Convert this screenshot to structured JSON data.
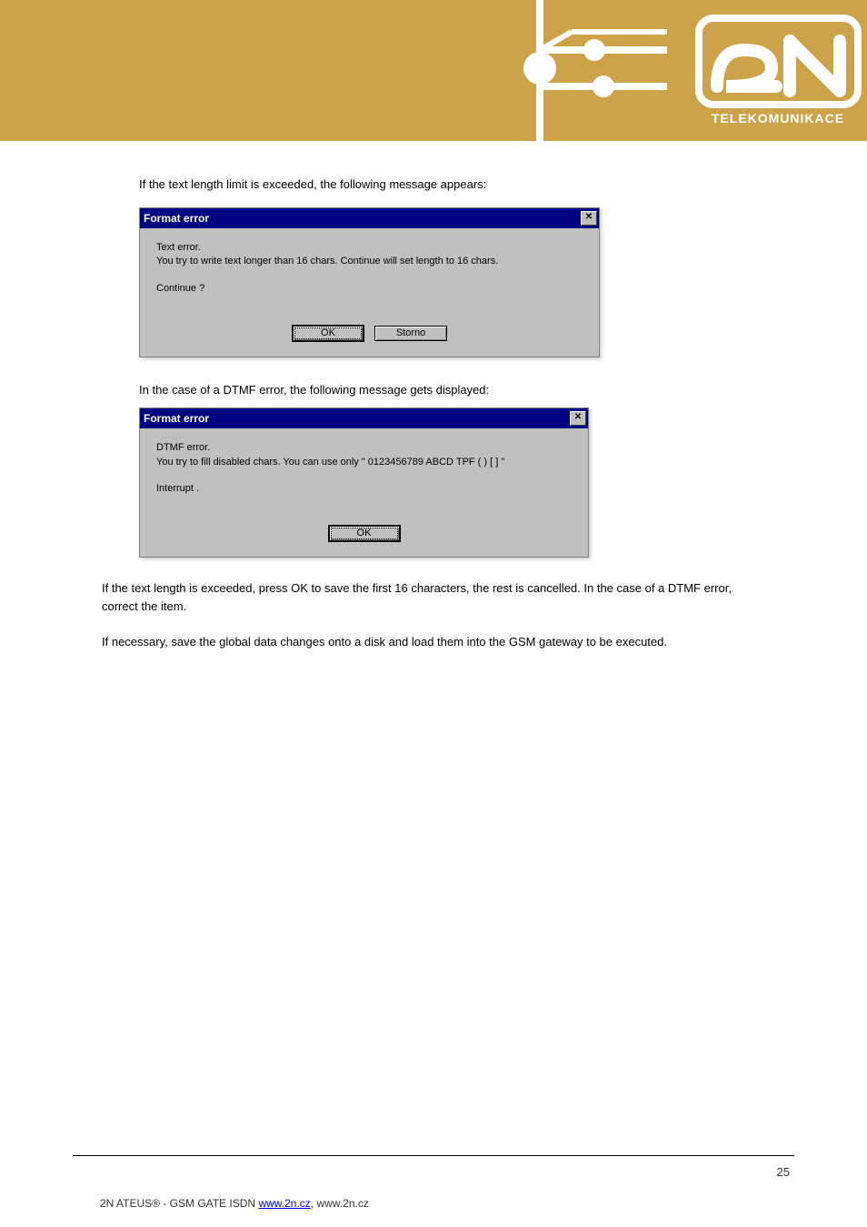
{
  "header": {
    "brand_text": "TELEKOMUNIKACE"
  },
  "intro": "If the text length limit is exceeded, the following message appears:",
  "dialog1": {
    "title": "Format error",
    "line1": "Text error.",
    "line2": "You try to write text longer than 16 chars. Continue will set length to 16 chars.",
    "line3": "Continue ?",
    "ok": "OK",
    "cancel": "Storno"
  },
  "mid": "In the case of a DTMF error, the following message gets displayed:",
  "dialog2": {
    "title": "Format error",
    "line1": "DTMF error.",
    "line2": "You try to fill disabled chars. You can use only \" 0123456789 ABCD TPF ( ) [ ] \"",
    "line3": "Interrupt .",
    "ok": "OK"
  },
  "below": {
    "p1": "If the text length is exceeded, press OK to save the first 16 characters, the rest is cancelled. In the case of a DTMF error, correct the item.",
    "p2": "If necessary, save the global data changes onto a disk and load them into the GSM gateway to be executed."
  },
  "footer": {
    "page": "25",
    "copy": "2N ",
    "brand": "ATEUS",
    "rest1": "® - GSM GATE ISDN ",
    "website_label": "www.2n.cz",
    "rest2": ", ",
    "domain": "www.2n.cz"
  }
}
